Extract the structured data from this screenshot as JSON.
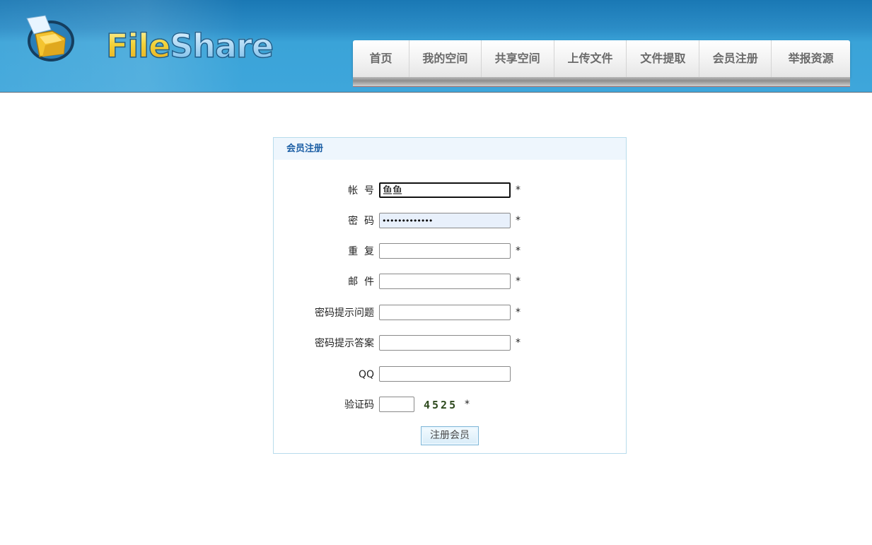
{
  "header": {
    "logo_part1": "File",
    "logo_part2": "Share",
    "nav": [
      {
        "label": "首页"
      },
      {
        "label": "我的空间"
      },
      {
        "label": "共享空间"
      },
      {
        "label": "上传文件"
      },
      {
        "label": "文件提取"
      },
      {
        "label": "会员注册"
      },
      {
        "label": "举报资源"
      }
    ]
  },
  "form": {
    "title": "会员注册",
    "fields": {
      "account": {
        "label": "帐  号",
        "value": "鱼鱼",
        "required": "*"
      },
      "password": {
        "label": "密  码",
        "value": "•••••••••••••",
        "required": "*"
      },
      "repeat": {
        "label": "重  复",
        "value": "",
        "required": "*"
      },
      "email": {
        "label": "邮  件",
        "value": "",
        "required": "*"
      },
      "question": {
        "label": "密码提示问题",
        "value": "",
        "required": "*"
      },
      "answer": {
        "label": "密码提示答案",
        "value": "",
        "required": "*"
      },
      "qq": {
        "label": "QQ",
        "value": ""
      },
      "captcha": {
        "label": "验证码",
        "value": "",
        "code": "4525",
        "required": "*"
      }
    },
    "submit_label": "注册会员"
  },
  "colors": {
    "header_blue": "#3ea6db",
    "panel_border": "#b8dcec",
    "title_blue": "#1c5fa5"
  }
}
